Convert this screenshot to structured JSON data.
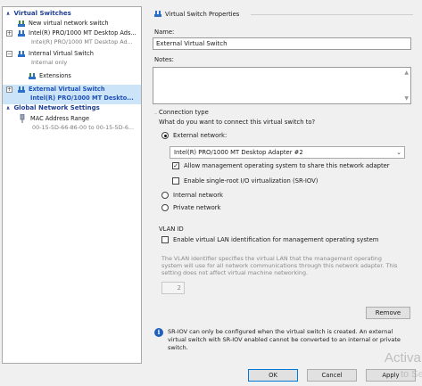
{
  "tree": {
    "virtual_switches_header": "Virtual Switches",
    "new_virtual_network_switch": "New virtual network switch",
    "switch1": {
      "name": "Intel(R) PRO/1000 MT Desktop Ads...",
      "sub": "Intel(R) PRO/1000 MT Desktop Ad..."
    },
    "switch2": {
      "name": "Internal Virtual Switch",
      "sub": "Internal only",
      "extensions": "Extensions"
    },
    "switch3": {
      "name": "External Virtual Switch",
      "sub": "Intel(R) PRO/1000 MT Deskto..."
    },
    "global_header": "Global Network Settings",
    "mac": {
      "name": "MAC Address Range",
      "sub": "00-15-5D-66-86-00 to 00-15-5D-6..."
    }
  },
  "props": {
    "section_title": "Virtual Switch Properties",
    "name_label": "Name:",
    "name_value": "External Virtual Switch",
    "notes_label": "Notes:",
    "connection_type_label": "Connection type",
    "connection_question": "What do you want to connect this virtual switch to?",
    "external_network": "External network:",
    "adapter": "Intel(R) PRO/1000 MT Desktop Adapter #2",
    "allow_mgmt": "Allow management operating system to share this network adapter",
    "enable_sriov": "Enable single-root I/O virtualization (SR-IOV)",
    "internal_network": "Internal network",
    "private_network": "Private network",
    "vlan_label": "VLAN ID",
    "enable_vlan": "Enable virtual LAN identification for management operating system",
    "vlan_desc_1": "The VLAN identifier specifies the virtual LAN that the management operating",
    "vlan_desc_2": "system will use for all network communications through this network adapter. This",
    "vlan_desc_3": "setting does not affect virtual machine networking.",
    "vlan_value": "2",
    "remove": "Remove",
    "info_1": "SR-IOV can only be configured when the virtual switch is created. An external",
    "info_2": "virtual switch with SR-IOV enabled cannot be converted to an internal or private",
    "info_3": "switch."
  },
  "buttons": {
    "ok": "OK",
    "cancel": "Cancel",
    "apply": "Apply"
  },
  "watermark": {
    "line1": "Activa",
    "line2": "to Se"
  },
  "colors": {
    "accent": "#1f52b8",
    "selection": "#cce4f7",
    "info": "#1f5fbf"
  }
}
